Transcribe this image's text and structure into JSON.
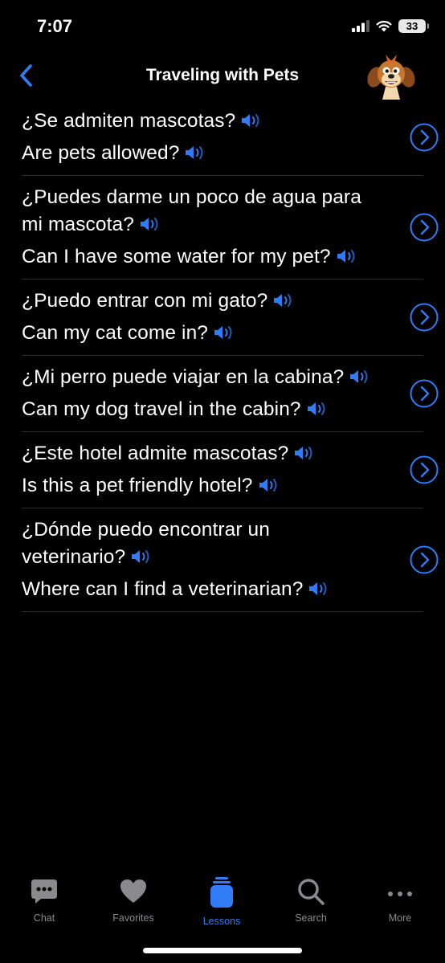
{
  "status_bar": {
    "time": "7:07",
    "battery": "33"
  },
  "nav": {
    "title": "Traveling with Pets",
    "back_icon": "chevron-left-icon",
    "avatar_icon": "cartoon-dog-icon"
  },
  "colors": {
    "accent": "#2f7cf6",
    "background": "#000000",
    "divider": "#2c2c2e",
    "inactive_tab": "#8a8a8e"
  },
  "phrases": [
    {
      "spanish": "¿Se admiten mascotas?",
      "english": "Are pets allowed?"
    },
    {
      "spanish": "¿Puedes darme un poco de agua para mi mascota?",
      "english": "Can I have some water for my pet?"
    },
    {
      "spanish": "¿Puedo entrar con mi gato?",
      "english": "Can my cat come in?"
    },
    {
      "spanish": "¿Mi perro puede viajar en la cabina?",
      "english": "Can my dog travel in the cabin?"
    },
    {
      "spanish": "¿Este hotel admite mascotas?",
      "english": "Is this a pet friendly hotel?"
    },
    {
      "spanish": "¿Dónde puedo encontrar un veterinario?",
      "english": "Where can I find a veterinarian?"
    }
  ],
  "tabs": [
    {
      "label": "Chat",
      "icon": "chat-bubble-icon"
    },
    {
      "label": "Favorites",
      "icon": "heart-icon"
    },
    {
      "label": "Lessons",
      "icon": "lessons-icon",
      "active": true
    },
    {
      "label": "Search",
      "icon": "search-icon"
    },
    {
      "label": "More",
      "icon": "more-icon"
    }
  ]
}
